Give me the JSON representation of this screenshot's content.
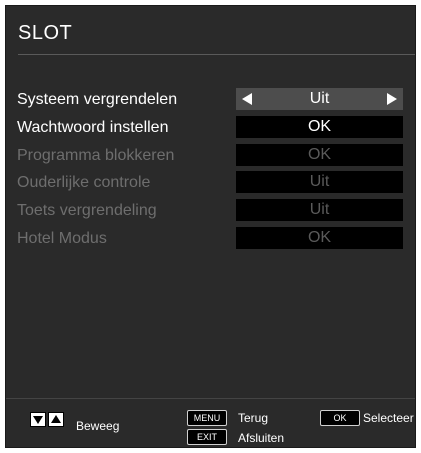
{
  "menu": {
    "title": "SLOT",
    "rows": [
      {
        "label": "Systeem vergrendelen",
        "value": "Uit",
        "enabled": true
      },
      {
        "label": "Wachtwoord instellen",
        "value": "OK",
        "enabled": true
      },
      {
        "label": "Programma blokkeren",
        "value": "OK",
        "enabled": false
      },
      {
        "label": "Ouderlijke controle",
        "value": "Uit",
        "enabled": false
      },
      {
        "label": "Toets vergrendeling",
        "value": "Uit",
        "enabled": false
      },
      {
        "label": "Hotel Modus",
        "value": "OK",
        "enabled": false
      }
    ]
  },
  "footer": {
    "move_label": "Beweeg",
    "menu_key": "MENU",
    "back_label": "Terug",
    "exit_key": "EXIT",
    "exit_label": "Afsluiten",
    "ok_key": "OK",
    "select_label": "Selecteer"
  },
  "colors": {
    "panel": "#2a2a2a",
    "enabled_text": "#ffffff",
    "disabled_text": "#6e6e6e",
    "value_box": "#000000",
    "selected_box": "#4d4d4d"
  }
}
